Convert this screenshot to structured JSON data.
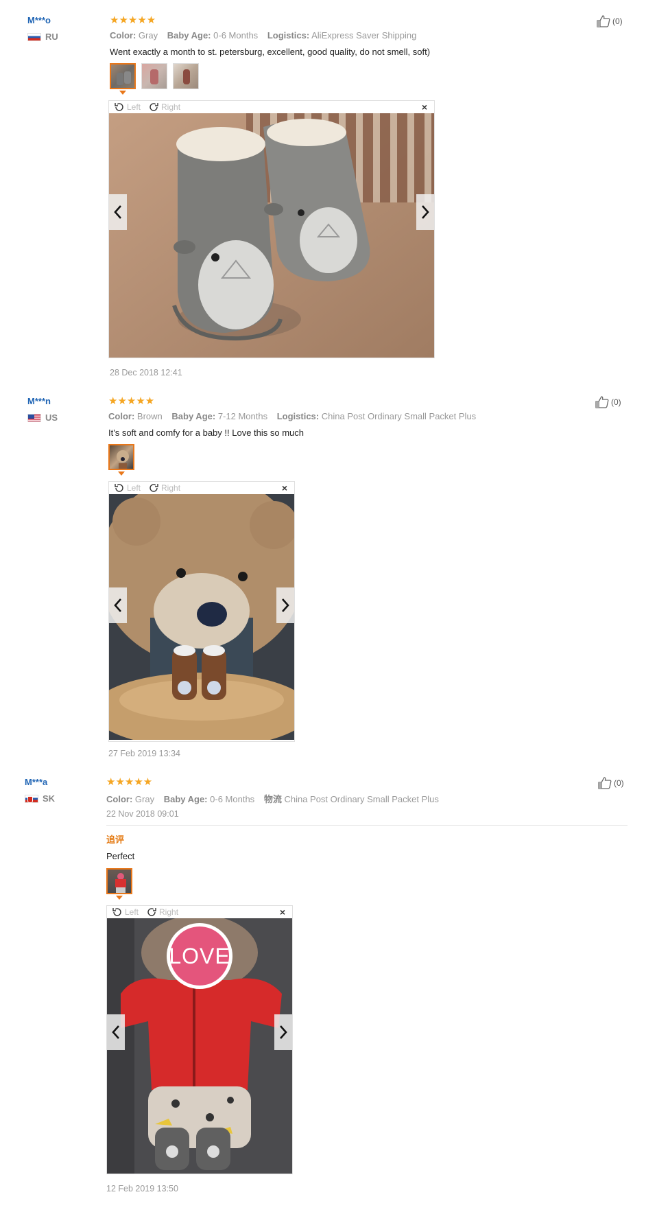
{
  "reviews": [
    {
      "user": "M***o",
      "country": "RU",
      "stars": "★★★★★",
      "attributes": [
        {
          "key": "Color:",
          "value": "Gray"
        },
        {
          "key": "Baby Age:",
          "value": "0-6 Months"
        },
        {
          "key": "Logistics:",
          "value": "AliExpress Saver Shipping"
        }
      ],
      "text": "Went exactly a month to st. petersburg, excellent, good quality, do not smell, soft)",
      "date": "28 Dec 2018 12:41",
      "helpful": "(0)",
      "viewer": {
        "left_label": "Left",
        "right_label": "Right",
        "close": "×"
      }
    },
    {
      "user": "M***n",
      "country": "US",
      "stars": "★★★★★",
      "attributes": [
        {
          "key": "Color:",
          "value": "Brown"
        },
        {
          "key": "Baby Age:",
          "value": "7-12 Months"
        },
        {
          "key": "Logistics:",
          "value": "China Post Ordinary Small Packet Plus"
        }
      ],
      "text": "It's soft and comfy for a baby !! Love this so much",
      "date": "27 Feb 2019 13:34",
      "helpful": "(0)",
      "viewer": {
        "left_label": "Left",
        "right_label": "Right",
        "close": "×"
      }
    },
    {
      "user": "M***a",
      "country": "SK",
      "stars": "★★★★★",
      "attributes": [
        {
          "key": "Color:",
          "value": "Gray"
        },
        {
          "key": "Baby Age:",
          "value": "0-6 Months"
        },
        {
          "key": "物流",
          "value": "China Post Ordinary Small Packet Plus"
        }
      ],
      "date": "22 Nov 2018 09:01",
      "followup_label": "追评",
      "followup_text": "Perfect",
      "followup_date": "12 Feb 2019 13:50",
      "helpful": "(0)",
      "love_text": "LOVE",
      "viewer": {
        "left_label": "Left",
        "right_label": "Right",
        "close": "×"
      }
    }
  ]
}
